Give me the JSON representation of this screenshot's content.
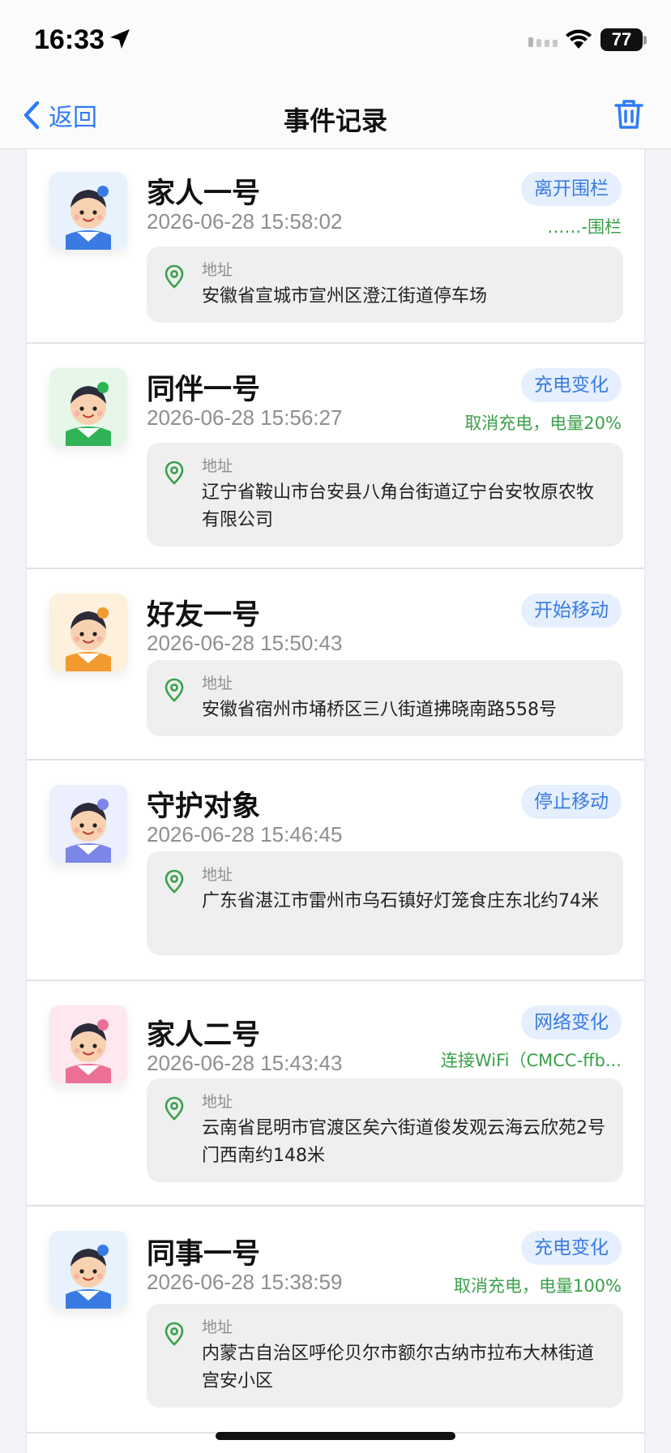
{
  "status_bar": {
    "time": "16:33",
    "battery": "77"
  },
  "nav": {
    "back_label": "返回",
    "title": "事件记录"
  },
  "events": [
    {
      "name": "家人一号",
      "time": "2026-06-28 15:58:02",
      "tag": "离开围栏",
      "sub": "……-围栏",
      "address_label": "地址",
      "address": "安徽省宣城市宣州区澄江街道停车场",
      "avatar_color": "#3a7be3",
      "avatar_bg": "#e8f2fd"
    },
    {
      "name": "同伴一号",
      "time": "2026-06-28 15:56:27",
      "tag": "充电变化",
      "sub": "取消充电，电量20%",
      "address_label": "地址",
      "address": "辽宁省鞍山市台安县八角台街道辽宁台安牧原农牧有限公司",
      "avatar_color": "#2fb356",
      "avatar_bg": "#e6f7ea"
    },
    {
      "name": "好友一号",
      "time": "2026-06-28 15:50:43",
      "tag": "开始移动",
      "sub": "",
      "address_label": "地址",
      "address": "安徽省宿州市埇桥区三八街道拂晓南路558号",
      "avatar_color": "#f29a30",
      "avatar_bg": "#fdf0dc"
    },
    {
      "name": "守护对象",
      "time": "2026-06-28 15:46:45",
      "tag": "停止移动",
      "sub": "",
      "address_label": "地址",
      "address": "广东省湛江市雷州市乌石镇好灯笼食庄东北约74米",
      "avatar_color": "#7b86e8",
      "avatar_bg": "#eceffd"
    },
    {
      "name": "家人二号",
      "time": "2026-06-28 15:43:43",
      "tag": "网络变化",
      "sub": "连接WiFi（CMCC-ffb...",
      "address_label": "地址",
      "address": "云南省昆明市官渡区矣六街道俊发观云海云欣苑2号门西南约148米",
      "avatar_color": "#ec6f96",
      "avatar_bg": "#fde8ef"
    },
    {
      "name": "同事一号",
      "time": "2026-06-28 15:38:59",
      "tag": "充电变化",
      "sub": "取消充电，电量100%",
      "address_label": "地址",
      "address": "内蒙古自治区呼伦贝尔市额尔古纳市拉布大林街道宫安小区",
      "avatar_color": "#3a7be3",
      "avatar_bg": "#e8f2fd"
    }
  ]
}
